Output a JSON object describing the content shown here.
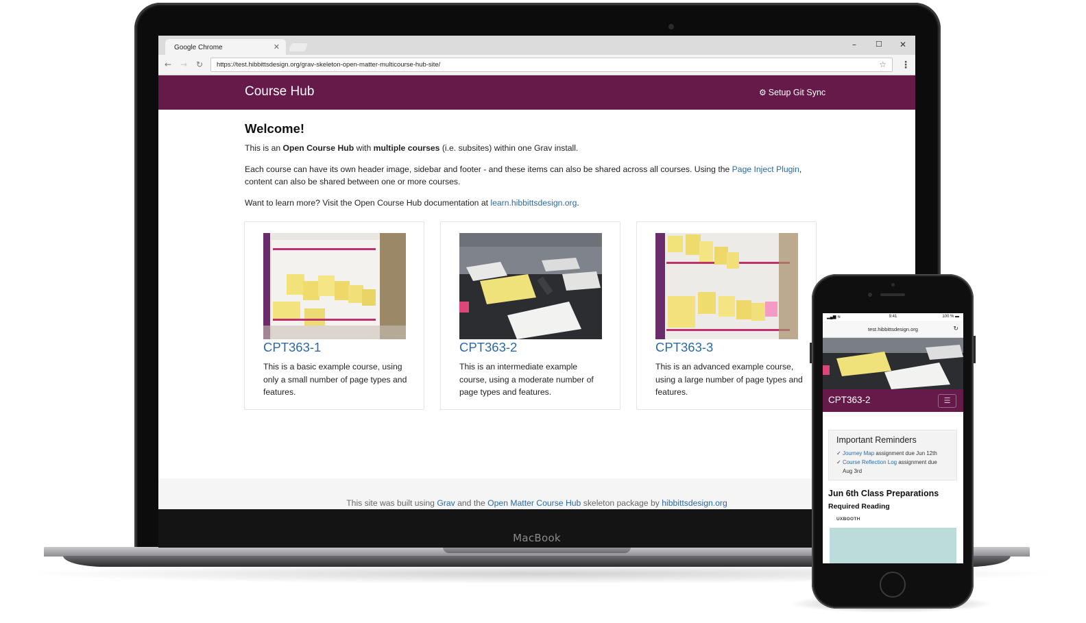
{
  "device": {
    "laptop_label": "MacBook"
  },
  "browser": {
    "tab_title": "Google Chrome",
    "url": "https://test.hibbittsdesign.org/grav-skeleton-open-matter-multicourse-hub-site/"
  },
  "site": {
    "title": "Course Hub",
    "git_sync_label": "Setup Git Sync"
  },
  "main": {
    "heading": "Welcome!",
    "intro": {
      "before": "This is an ",
      "strong1": "Open Course Hub",
      "middle": " with ",
      "strong2": "multiple courses",
      "after": " (i.e. subsites) within one Grav install."
    },
    "para2": {
      "before": "Each course can have its own header image, sidebar and footer - and these items can also be shared across all courses. Using the ",
      "link": "Page Inject Plugin",
      "after": ", content can also be shared between one or more courses."
    },
    "para3": {
      "before": "Want to learn more? Visit the Open Course Hub documentation at ",
      "link": "learn.hibbittsdesign.org",
      "after": "."
    },
    "courses": [
      {
        "title": "CPT363-1",
        "description": "This is a basic example course, using only a small number of page types and features."
      },
      {
        "title": "CPT363-2",
        "description": "This is an intermediate example course, using a moderate number of page types and features."
      },
      {
        "title": "CPT363-3",
        "description": "This is an advanced example course, using a large number of page types and features."
      }
    ]
  },
  "footer": {
    "before": "This site was built using ",
    "link1": "Grav",
    "middle": " and the ",
    "link2": "Open Matter Course Hub",
    "after": " skeleton package by ",
    "link3": "hibbittsdesign.org"
  },
  "phone": {
    "time": "9:41",
    "battery": "100 %",
    "url": "test.hibbittsdesign.org",
    "course_title": "CPT363-2",
    "reminders_title": "Important Reminders",
    "reminder1": {
      "check": "✓ ",
      "link": "Journey Map",
      "text": " assignment due Jun 12th"
    },
    "reminder2": {
      "check": "✓ ",
      "link": "Course Reflection Log",
      "text": " assignment due"
    },
    "reminder2_cont": "Aug 3rd",
    "section_heading": "Jun 6th Class Preparations",
    "subheading": "Required Reading",
    "source_label": "UXBOOTH"
  },
  "colors": {
    "brand": "#661a4a",
    "link": "#2a6aa8"
  }
}
